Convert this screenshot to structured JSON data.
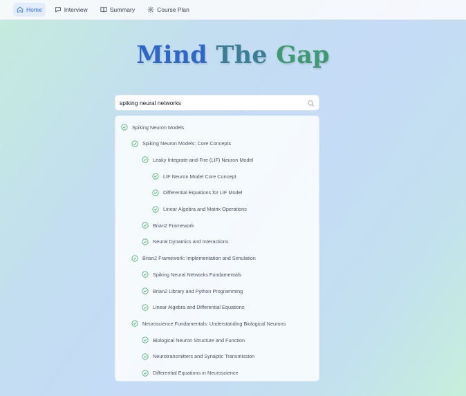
{
  "nav": {
    "items": [
      {
        "label": "Home",
        "icon": "home-icon",
        "active": true
      },
      {
        "label": "Interview",
        "icon": "chat-icon",
        "active": false
      },
      {
        "label": "Summary",
        "icon": "book-icon",
        "active": false
      },
      {
        "label": "Course Plan",
        "icon": "gear-icon",
        "active": false
      }
    ]
  },
  "title": {
    "part1": "Mind",
    "part2": "The",
    "part3": "Gap"
  },
  "search": {
    "value": "spiking neural networks",
    "icon": "search-icon"
  },
  "results": [
    {
      "label": "Spiking Neuron Models",
      "depth": 0,
      "status": "completed"
    },
    {
      "label": "Spiking Neuron Models: Core Concepts",
      "depth": 1,
      "status": "completed"
    },
    {
      "label": "Leaky Integrate-and-Fire (LIF) Neuron Model",
      "depth": 2,
      "status": "completed"
    },
    {
      "label": "LIF Neuron Model Core Concept",
      "depth": 3,
      "status": "completed"
    },
    {
      "label": "Differential Equations for LIF Model",
      "depth": 3,
      "status": "completed"
    },
    {
      "label": "Linear Algebra and Matrix Operations",
      "depth": 3,
      "status": "completed"
    },
    {
      "label": "Brian2 Framework",
      "depth": 2,
      "status": "completed"
    },
    {
      "label": "Neural Dynamics and Interactions",
      "depth": 2,
      "status": "completed"
    },
    {
      "label": "Brian2 Framework: Implementation and Simulation",
      "depth": 1,
      "status": "completed"
    },
    {
      "label": "Spiking Neural Networks Fundamentals",
      "depth": 2,
      "status": "completed"
    },
    {
      "label": "Brian2 Library and Python Programming",
      "depth": 2,
      "status": "completed"
    },
    {
      "label": "Linear Algebra and Differential Equations",
      "depth": 2,
      "status": "completed"
    },
    {
      "label": "Neuroscience Fundamentals: Understanding Biological Neurons",
      "depth": 1,
      "status": "completed"
    },
    {
      "label": "Biological Neuron Structure and Function",
      "depth": 2,
      "status": "completed"
    },
    {
      "label": "Neurotransmitters and Synaptic Transmission",
      "depth": 2,
      "status": "completed"
    },
    {
      "label": "Differential Equations in Neuroscience",
      "depth": 2,
      "status": "completed"
    }
  ],
  "colors": {
    "accent": "#2f6ed8",
    "check": "#4caf6a"
  }
}
